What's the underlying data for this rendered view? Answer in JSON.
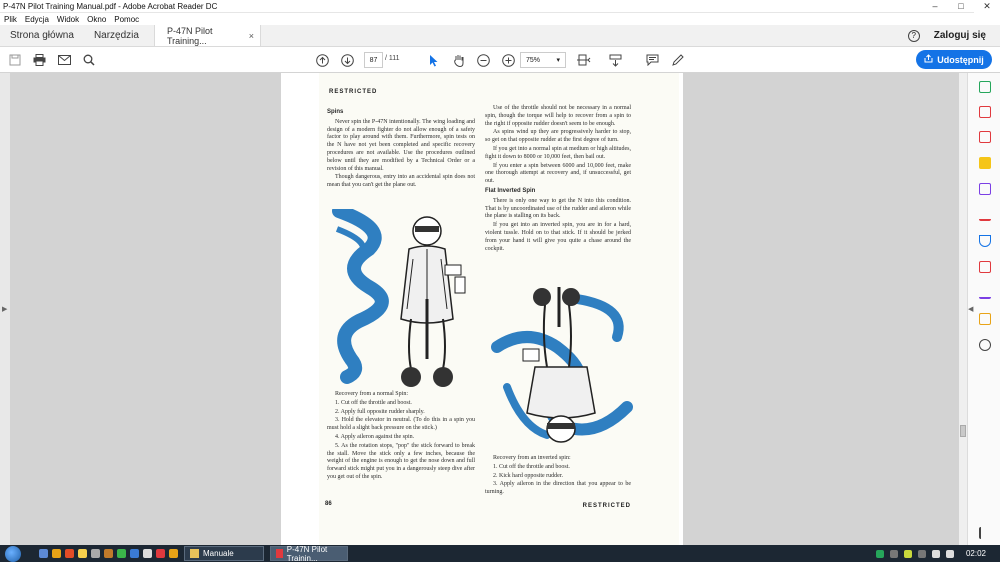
{
  "window": {
    "title": "P-47N Pilot Training Manual.pdf - Adobe Acrobat Reader DC",
    "controls": [
      "–",
      "□",
      "✕"
    ]
  },
  "menu": [
    "Plik",
    "Edycja",
    "Widok",
    "Okno",
    "Pomoc"
  ],
  "tabs": {
    "home": "Strona główna",
    "tools": "Narzędzia",
    "document": "P-47N Pilot Training...",
    "close": "×",
    "help": "?",
    "signin": "Zaloguj się"
  },
  "toolbar": {
    "current_page": "87",
    "page_of": "/ 111",
    "zoom": "75%",
    "share_label": "Udostępnij"
  },
  "document": {
    "header": "RESTRICTED",
    "footer": "RESTRICTED",
    "page_number": "86",
    "left_col": {
      "heading": "Spins",
      "p1": "Never spin the P-47N intentionally. The wing loading and design of a modern fighter do not allow enough of a safety factor to play around with them. Furthermore, spin tests on the N have not yet been completed and specific recovery procedures are not available. Use the procedures outlined below until they are modified by a Technical Order or a revision of this manual.",
      "p2": "Though dangerous, entry into an accidental spin does not mean that you can't get the plane out.",
      "recovery_title": "Recovery from a normal Spin:",
      "r1": "1. Cut off the throttle and boost.",
      "r2": "2. Apply full opposite rudder sharply.",
      "r3": "3. Hold the elevator in neutral. (To do this in a spin you must hold a slight back pressure on the stick.)",
      "r4": "4. Apply aileron against the spin.",
      "r5": "5. As the rotation stops, \"pop\" the stick forward to break the stall. Move the stick only a few inches, because the weight of the engine is enough to get the nose down and full forward stick might put you in a dangerously steep dive after you get out of the spin."
    },
    "right_col": {
      "p1": "Use of the throttle should not be necessary in a normal spin, though the torque will help to recover from a spin to the right if opposite rudder doesn't seem to be enough.",
      "p2": "As spins wind up they are progressively harder to stop, so get on that opposite rudder at the first degree of turn.",
      "p3": "If you get into a normal spin at medium or high altitudes, fight it down to 8000 or 10,000 feet, then bail out.",
      "p4": "If you enter a spin between 6000 and 10,000 feet, make one thorough attempt at recovery and, if unsuccessful, get out.",
      "heading": "Flat Inverted Spin",
      "p5": "There is only one way to get the N into this condition. That is by uncoordinated use of the rudder and aileron while the plane is stalling on its back.",
      "p6": "If you get into an inverted spin, you are in for a hard, violent tussle. Hold on to that stick. If it should be jerked from your hand it will give you quite a chase around the cockpit.",
      "recovery_title": "Recovery from an inverted spin:",
      "r1": "1. Cut off the throttle and boost.",
      "r2": "2. Kick hard opposite rudder.",
      "r3": "3. Apply aileron in the direction that you appear to be turning."
    }
  },
  "taskbar": {
    "item1": "Manuale",
    "item2": "P-47N Pilot Trainin...",
    "time": "02:02"
  }
}
